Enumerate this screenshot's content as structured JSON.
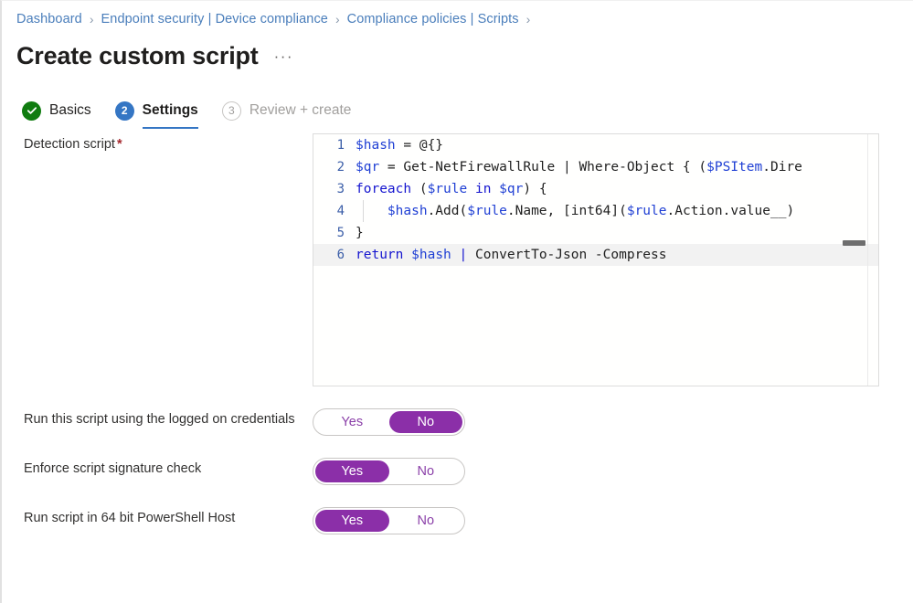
{
  "breadcrumb": {
    "separator": "›",
    "items": [
      {
        "label": "Dashboard"
      },
      {
        "label": "Endpoint security | Device compliance"
      },
      {
        "label": "Compliance policies | Scripts"
      }
    ]
  },
  "header": {
    "title": "Create custom script",
    "more_actions": "···"
  },
  "wizard": {
    "steps": [
      {
        "badge": "✓",
        "label": "Basics",
        "state": "done"
      },
      {
        "badge": "2",
        "label": "Settings",
        "state": "active"
      },
      {
        "badge": "3",
        "label": "Review + create",
        "state": "todo"
      }
    ]
  },
  "form": {
    "detection_script": {
      "label": "Detection script",
      "required_marker": "*",
      "editor": {
        "lines": [
          {
            "num": "1",
            "text": "$hash = @{}"
          },
          {
            "num": "2",
            "text": "$qr = Get-NetFirewallRule | Where-Object { ($PSItem.Dire"
          },
          {
            "num": "3",
            "text": "foreach ($rule in $qr) {"
          },
          {
            "num": "4",
            "text": "    $hash.Add($rule.Name, [int64]($rule.Action.value__)"
          },
          {
            "num": "5",
            "text": "}"
          },
          {
            "num": "6",
            "text": "return $hash | ConvertTo-Json -Compress"
          }
        ]
      }
    },
    "toggles": [
      {
        "label": "Run this script using the logged on credentials",
        "yes_label": "Yes",
        "no_label": "No",
        "value": "No"
      },
      {
        "label": "Enforce script signature check",
        "yes_label": "Yes",
        "no_label": "No",
        "value": "Yes"
      },
      {
        "label": "Run script in 64 bit PowerShell Host",
        "yes_label": "Yes",
        "no_label": "No",
        "value": "Yes"
      }
    ]
  },
  "colors": {
    "link": "#4a7ebb",
    "accent_blue": "#3576c4",
    "success_green": "#107c10",
    "toggle_purple": "#8b2fa8",
    "required_red": "#a4262c",
    "code_keyword": "#1414cf"
  }
}
